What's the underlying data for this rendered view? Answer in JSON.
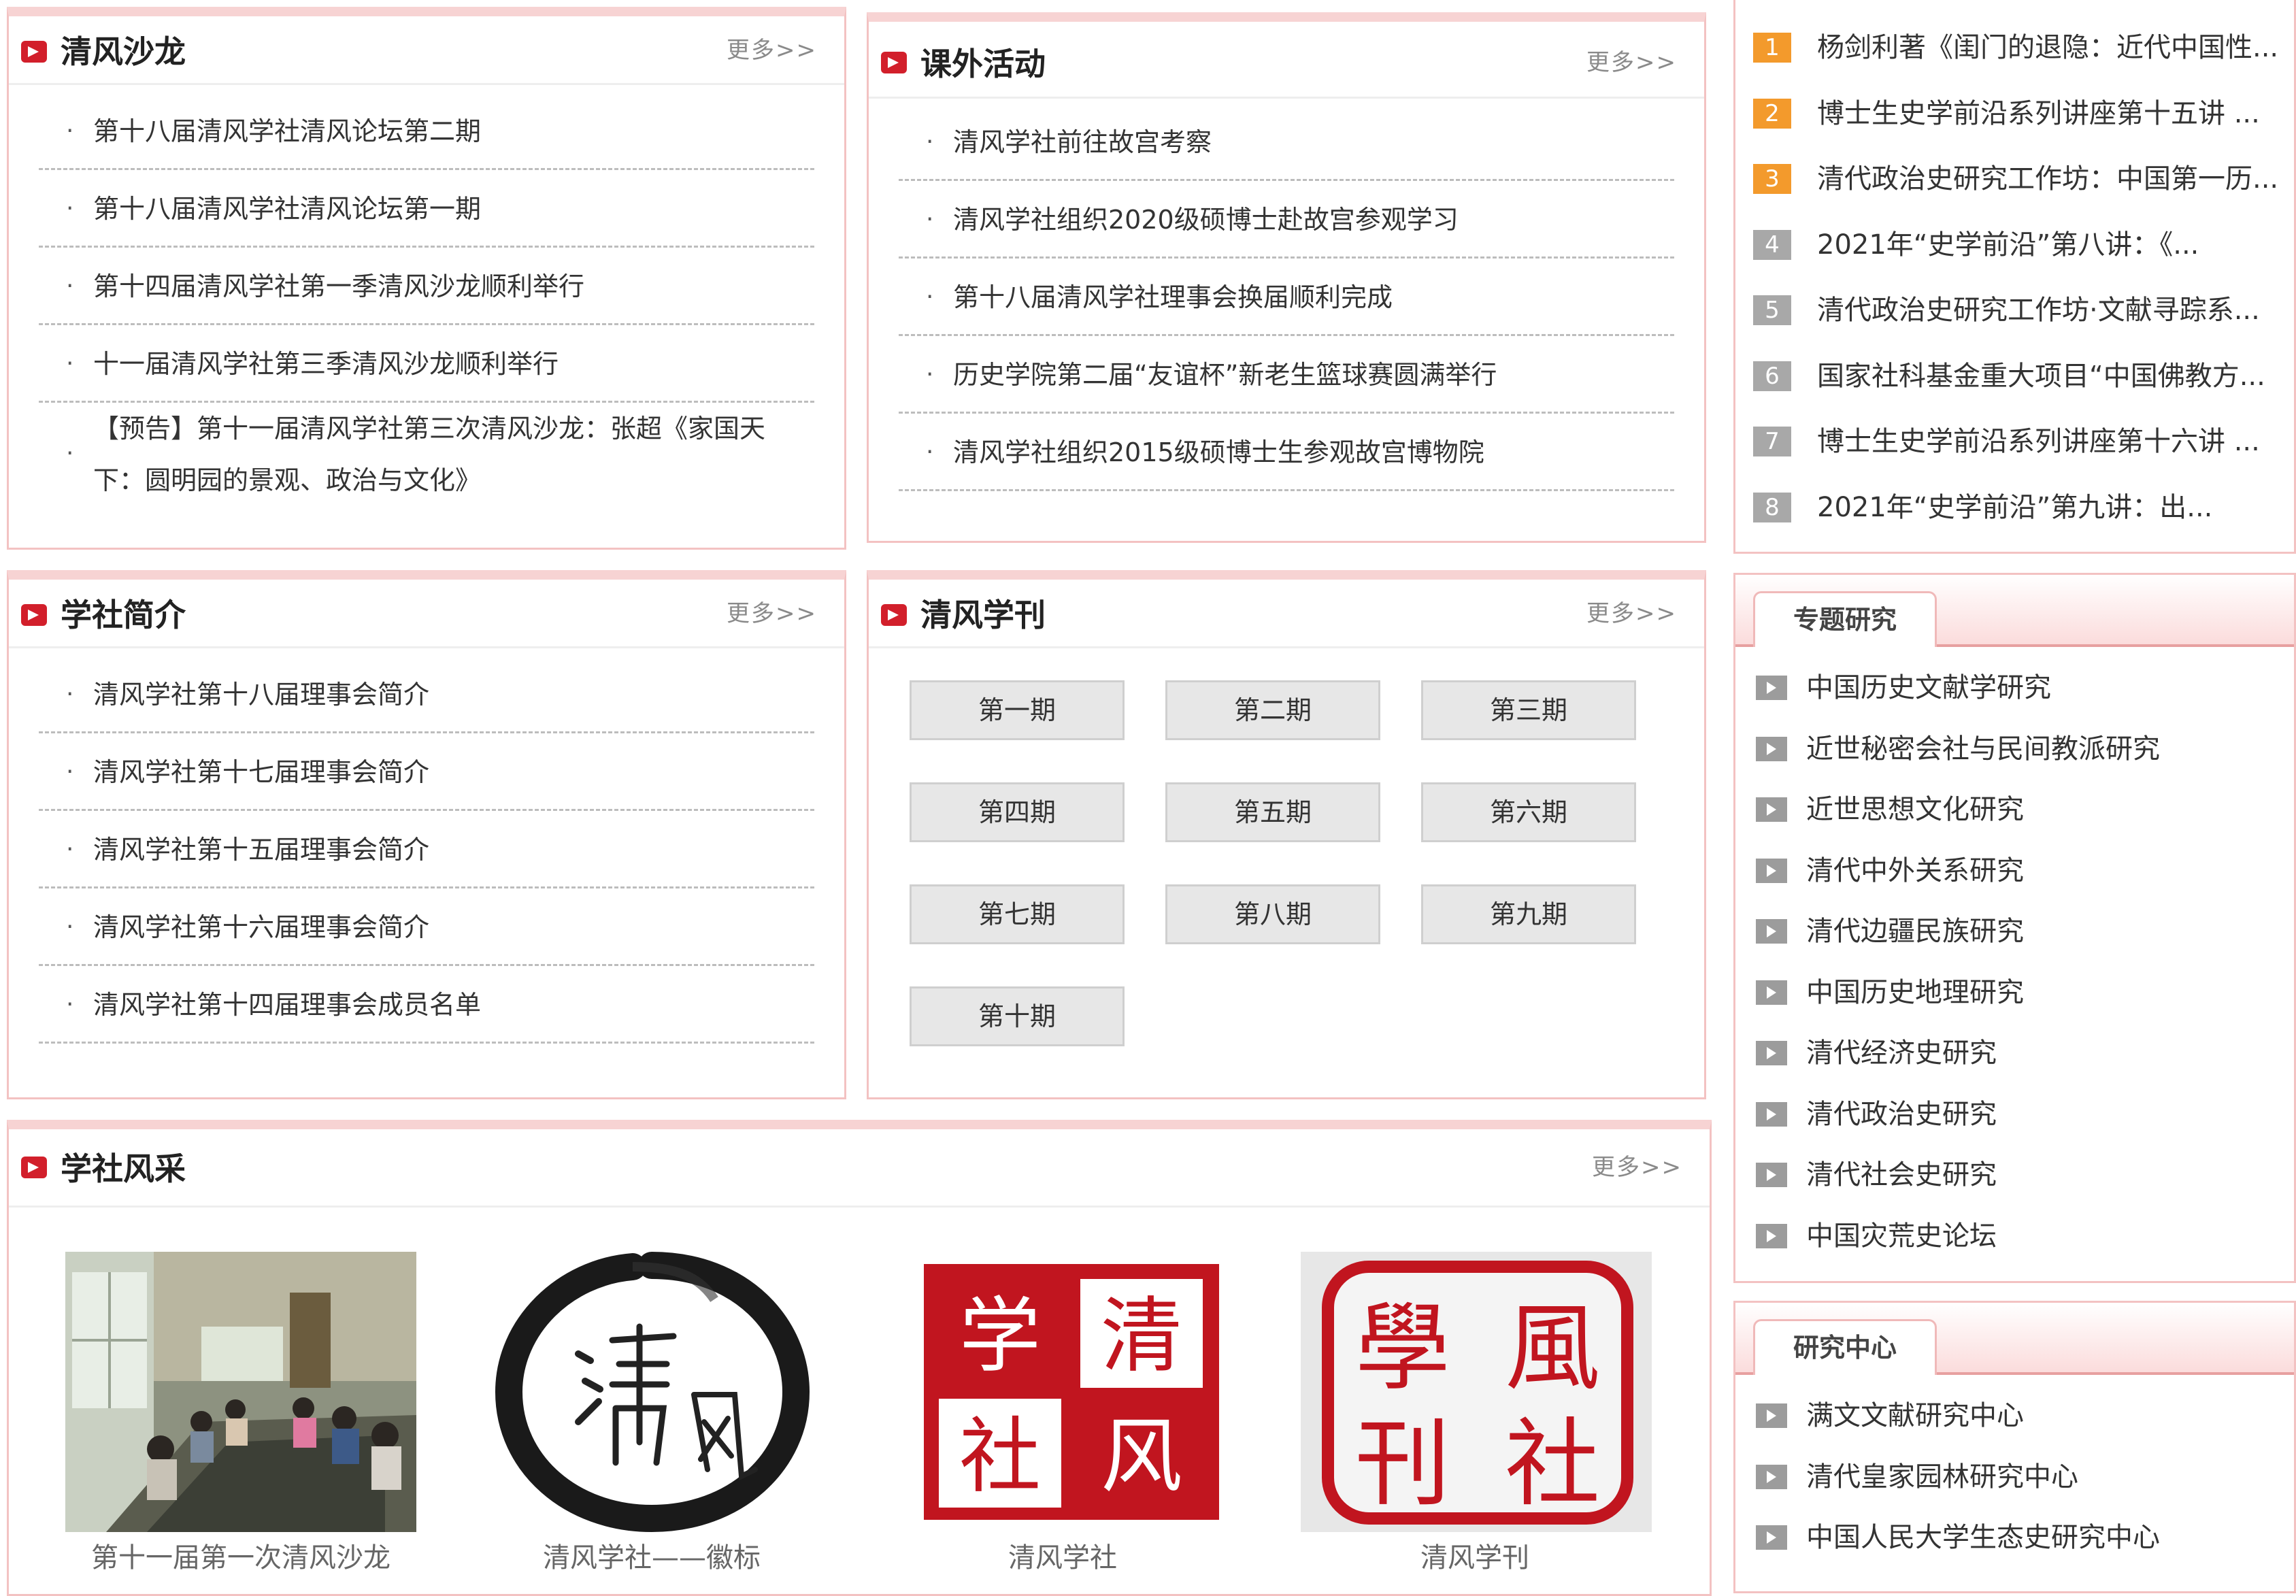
{
  "more_label": "更多>>",
  "salon": {
    "title": "清风沙龙",
    "items": [
      "第十八届清风学社清风论坛第二期",
      "第十八届清风学社清风论坛第一期",
      "第十四届清风学社第一季清风沙龙顺利举行",
      "十一届清风学社第三季清风沙龙顺利举行",
      "【预告】第十一届清风学社第三次清风沙龙：张超《家国天下：圆明园的景观、政治与文化》"
    ]
  },
  "activities": {
    "title": "课外活动",
    "items": [
      "清风学社前往故宫考察",
      "清风学社组织2020级硕博士赴故宫参观学习",
      "第十八届清风学社理事会换届顺利完成",
      "历史学院第二届“友谊杯”新老生篮球赛圆满举行",
      "清风学社组织2015级硕博士生参观故宫博物院"
    ]
  },
  "intro": {
    "title": "学社简介",
    "items": [
      "清风学社第十八届理事会简介",
      "清风学社第十七届理事会简介",
      "清风学社第十五届理事会简介",
      "清风学社第十六届理事会简介",
      "清风学社第十四届理事会成员名单"
    ]
  },
  "journal": {
    "title": "清风学刊",
    "issues": [
      "第一期",
      "第二期",
      "第三期",
      "第四期",
      "第五期",
      "第六期",
      "第七期",
      "第八期",
      "第九期",
      "第十期"
    ]
  },
  "gallery": {
    "title": "学社风采",
    "items": [
      {
        "caption": "第十一届第一次清风沙龙"
      },
      {
        "caption": "清风学社——徽标"
      },
      {
        "caption": "清风学社",
        "seal_text": [
          "学",
          "清",
          "社",
          "风"
        ]
      },
      {
        "caption": "清风学刊",
        "seal_text": [
          "學",
          "風",
          "刊",
          "社"
        ]
      }
    ]
  },
  "ranking": {
    "items": [
      {
        "num": "1",
        "text": "杨剑利著《闺门的退隐：近代中国性..."
      },
      {
        "num": "2",
        "text": "博士生史学前沿系列讲座第十五讲 ..."
      },
      {
        "num": "3",
        "text": "清代政治史研究工作坊：中国第一历..."
      },
      {
        "num": "4",
        "text": "2021年“史学前沿”第八讲：《..."
      },
      {
        "num": "5",
        "text": "清代政治史研究工作坊·文献寻踪系..."
      },
      {
        "num": "6",
        "text": "国家社科基金重大项目“中国佛教方..."
      },
      {
        "num": "7",
        "text": "博士生史学前沿系列讲座第十六讲 ..."
      },
      {
        "num": "8",
        "text": "2021年“史学前沿”第九讲：出..."
      }
    ],
    "top_color": "#f39a2c",
    "other_color": "#a8a8a8"
  },
  "topics": {
    "title": "专题研究",
    "items": [
      "中国历史文献学研究",
      "近世秘密会社与民间教派研究",
      "近世思想文化研究",
      "清代中外关系研究",
      "清代边疆民族研究",
      "中国历史地理研究",
      "清代经济史研究",
      "清代政治史研究",
      "清代社会史研究",
      "中国灾荒史论坛"
    ]
  },
  "centers": {
    "title": "研究中心",
    "items": [
      "满文文献研究中心",
      "清代皇家园林研究中心",
      "中国人民大学生态史研究中心"
    ]
  }
}
